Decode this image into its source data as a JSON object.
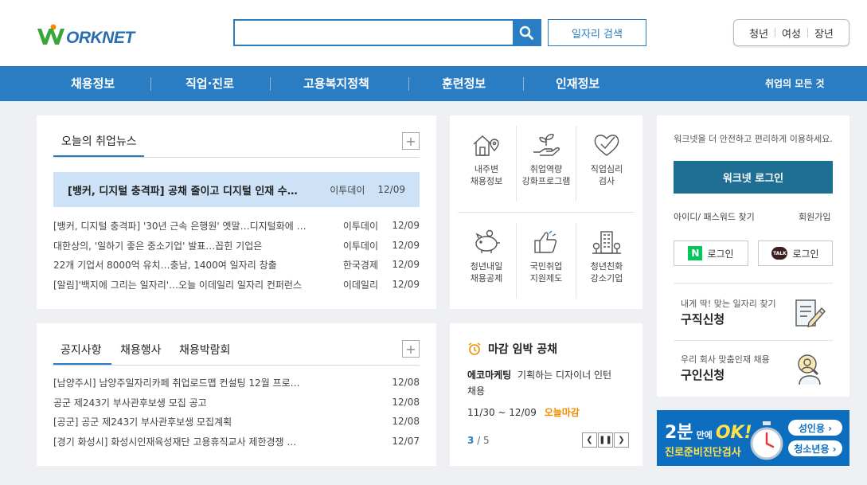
{
  "logo": {
    "text": "ORKNET"
  },
  "search": {
    "placeholder": "",
    "job_search_label": "일자리 검색"
  },
  "user_types": [
    "청년",
    "여성",
    "장년"
  ],
  "nav": {
    "items": [
      "채용정보",
      "직업·진로",
      "고용복지정책",
      "훈련정보",
      "인재정보"
    ],
    "all_label": "취업의 모든 것"
  },
  "news": {
    "tab": "오늘의 취업뉴스",
    "headline": {
      "title": "[뱅커, 디지털 충격파] 공채 줄이고 디지털 인재 수…",
      "source": "이투데이",
      "date": "12/09"
    },
    "items": [
      {
        "title": "[뱅커, 디지털 충격파] '30년 근속 은행원' 옛말…디지털화에 …",
        "source": "이투데이",
        "date": "12/09"
      },
      {
        "title": "대한상의, '일하기 좋은 중소기업' 발표…꼽힌 기업은",
        "source": "이투데이",
        "date": "12/09"
      },
      {
        "title": "22개 기업서 8000억 유치…충남, 1400여 일자리 창출",
        "source": "한국경제",
        "date": "12/09"
      },
      {
        "title": "[알림]'백지에 그리는 일자리'…오늘 이데일리 일자리 컨퍼런스",
        "source": "이데일리",
        "date": "12/09"
      }
    ]
  },
  "notice": {
    "tabs": [
      "공지사항",
      "채용행사",
      "채용박람회"
    ],
    "items": [
      {
        "title": "[남양주시] 남양주일자리카페 취업로드맵 컨설팅 12월 프로…",
        "date": "12/08"
      },
      {
        "title": "공군 제243기 부사관후보생 모집 공고",
        "date": "12/08"
      },
      {
        "title": "[공군] 공군 제243기 부사관후보생 모집계획",
        "date": "12/08"
      },
      {
        "title": "[경기 화성시] 화성시인재육성재단 고용휴직교사 제한경쟁 …",
        "date": "12/07"
      }
    ]
  },
  "services": [
    {
      "line1": "내주변",
      "line2": "채용정보",
      "icon": "house-location-icon"
    },
    {
      "line1": "취업역량",
      "line2": "강화프로그램",
      "icon": "hand-sprout-icon"
    },
    {
      "line1": "직업심리",
      "line2": "검사",
      "icon": "heart-check-icon"
    },
    {
      "line1": "청년내일",
      "line2": "채용공제",
      "icon": "piggy-bank-icon"
    },
    {
      "line1": "국민취업",
      "line2": "지원제도",
      "icon": "thumbs-up-icon"
    },
    {
      "line1": "청년친화",
      "line2": "강소기업",
      "icon": "building-icon"
    }
  ],
  "deadline": {
    "title": "마감 임박 공채",
    "company": "에코마케팅",
    "job_line1": "기획하는 디자이너 인턴",
    "job_line2": "채용",
    "period": "11/30 ~ 12/09",
    "status": "오늘마감",
    "page_current": "3",
    "page_total": "/ 5"
  },
  "login": {
    "hint": "워크넷을 더 안전하고 편리하게 이용하세요.",
    "button": "워크넷 로그인",
    "find": "아이디/ 패스워드 찾기",
    "join": "회원가입",
    "naver": "로그인",
    "kakao": "로그인",
    "naver_mark": "N",
    "kakao_mark": "TALK"
  },
  "apply": [
    {
      "sub": "내게 딱! 맞는 일자리 찾기",
      "main": "구직신청"
    },
    {
      "sub": "우리 회사 맞춤인재 채용",
      "main": "구인신청"
    }
  ],
  "banner": {
    "big": "2분",
    "mid": "만에",
    "ok": "OK!",
    "title": "진로준비진단검사",
    "btn1": "성인용 ›",
    "btn2": "청소년용 ›"
  },
  "colors": {
    "primary": "#2a7dc2",
    "login": "#1f6f94",
    "deadline": "#f28c00",
    "naver": "#03c75a",
    "kakao": "#3c1e1e"
  }
}
